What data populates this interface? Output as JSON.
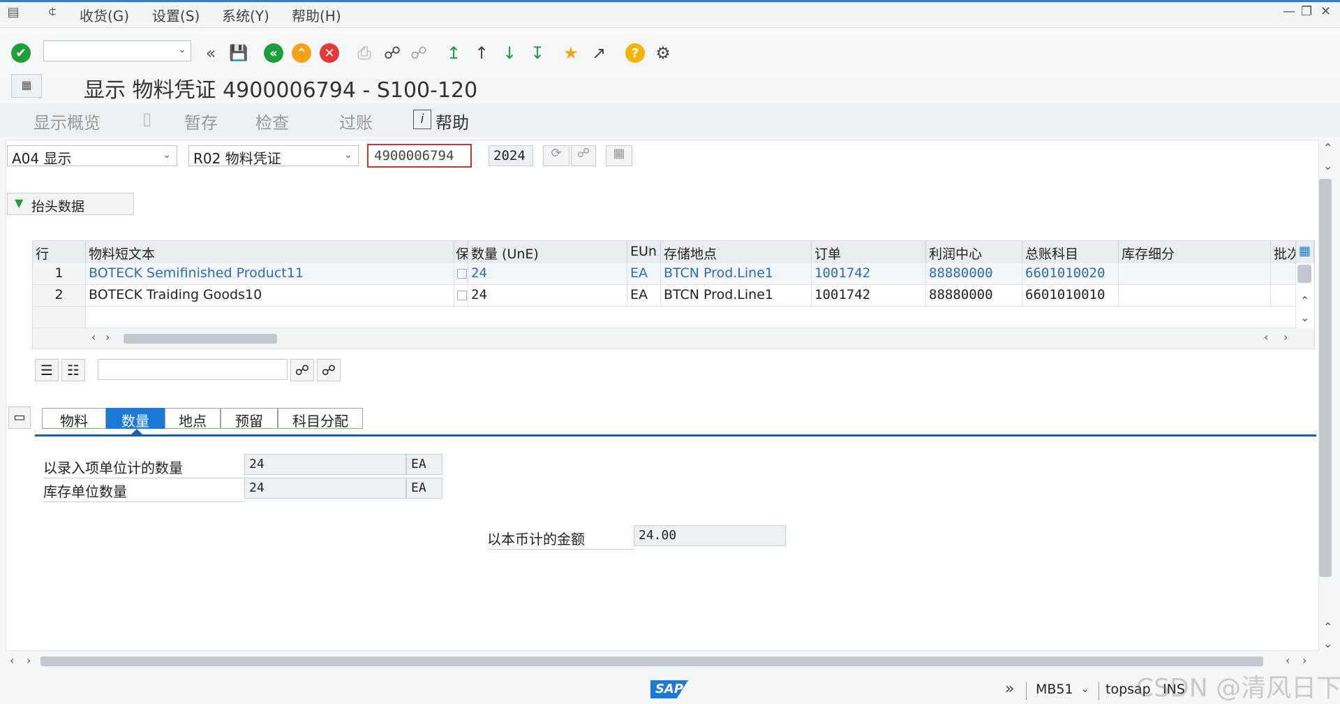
{
  "menu": {
    "items": [
      "收货(G)",
      "设置(S)",
      "系统(Y)",
      "帮助(H)"
    ]
  },
  "title": "显示 物料凭证 4900006794 - S100-120",
  "app_toolbar": {
    "overview": "显示概览",
    "hold": "暂存",
    "check": "检查",
    "post": "过账",
    "help": "帮助"
  },
  "selection": {
    "action": "A04 显示",
    "ref_doc": "R02 物料凭证",
    "doc_number": "4900006794",
    "year": "2024"
  },
  "header_button": "抬头数据",
  "table": {
    "columns": [
      "行",
      "物料短文本",
      "保",
      "数量 (UnE)",
      "EUn",
      "存储地点",
      "订单",
      "利润中心",
      "总账科目",
      "库存细分",
      "批次"
    ],
    "rows": [
      {
        "line": "1",
        "text": "BOTECK Semifinished Product11",
        "qty": "24",
        "eun": "EA",
        "sloc": "BTCN Prod.Line1",
        "order": "1001742",
        "profit_center": "88880000",
        "gl": "6601010020",
        "stock_seg": ""
      },
      {
        "line": "2",
        "text": "BOTECK Traiding Goods10",
        "qty": "24",
        "eun": "EA",
        "sloc": "BTCN Prod.Line1",
        "order": "1001742",
        "profit_center": "88880000",
        "gl": "6601010010",
        "stock_seg": ""
      }
    ]
  },
  "tabs": [
    "物料",
    "数量",
    "地点",
    "预留",
    "科目分配"
  ],
  "active_tab": "数量",
  "quantity": {
    "entry_label": "以录入项单位计的数量",
    "entry_value": "24",
    "entry_unit": "EA",
    "stock_label": "库存单位数量",
    "stock_value": "24",
    "stock_unit": "EA",
    "amount_label": "以本币计的金额",
    "amount_value": "24.00"
  },
  "status": {
    "transaction": "MB51",
    "system": "topsap",
    "mode": "INS",
    "logo": "SAP",
    "watermark": "CSDN @清风日下"
  },
  "colors": {
    "accent": "#1b7ad6",
    "ok": "#1f9e3c",
    "cancel": "#e23b3b",
    "exit": "#f4a316",
    "link": "#2b6bb0"
  }
}
